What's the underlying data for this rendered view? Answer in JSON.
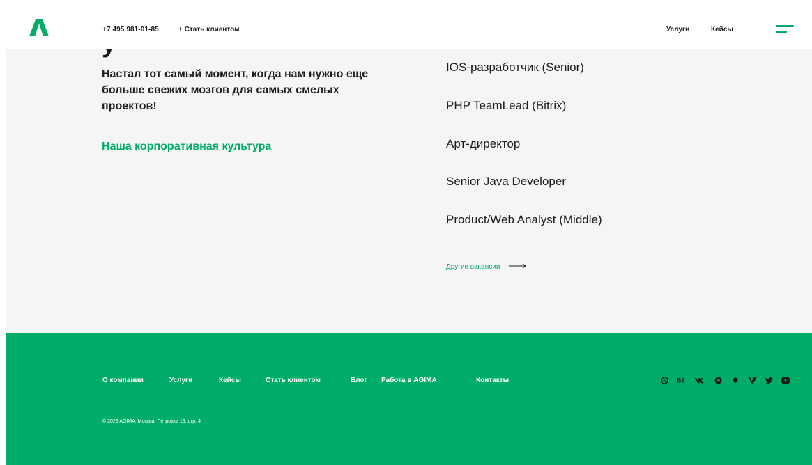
{
  "header": {
    "phone": "+7 495 981-01-85",
    "become_client": "+ Стать клиентом",
    "nav": [
      "Услуги",
      "Кейсы"
    ],
    "icons": [
      "agima-logo-icon",
      "burger-menu-icon"
    ]
  },
  "main": {
    "intro": "Настал тот самый момент, когда нам нужно еще больше свежих мозгов для самых смелых проектов!",
    "culture_link": "Наша корпоративная культура",
    "vacancies": [
      "IOS-разработчик (Senior)",
      "PHP TeamLead (Bitrix)",
      "Арт-директор",
      "Senior Java Developer",
      "Product/Web Analyst (Middle)"
    ],
    "other_vacancies": "Другие вакансии"
  },
  "footer": {
    "nav": [
      "О компании",
      "Услуги",
      "Кейсы",
      "Стать клиентом",
      "Блог",
      "Работа в AGIMA",
      "Контакты"
    ],
    "copyright": "© 2023 AGIMA. Москва, Петровка 19, стр. 4",
    "socials": [
      "dribbble-icon",
      "behance-icon",
      "vk-icon",
      "telegram-icon",
      "medium-icon",
      "vimeo-icon",
      "twitter-icon",
      "youtube-icon"
    ]
  },
  "colors": {
    "accent": "#00ad68",
    "text": "#1d1d1d",
    "section_bg": "#f5f5f5"
  }
}
